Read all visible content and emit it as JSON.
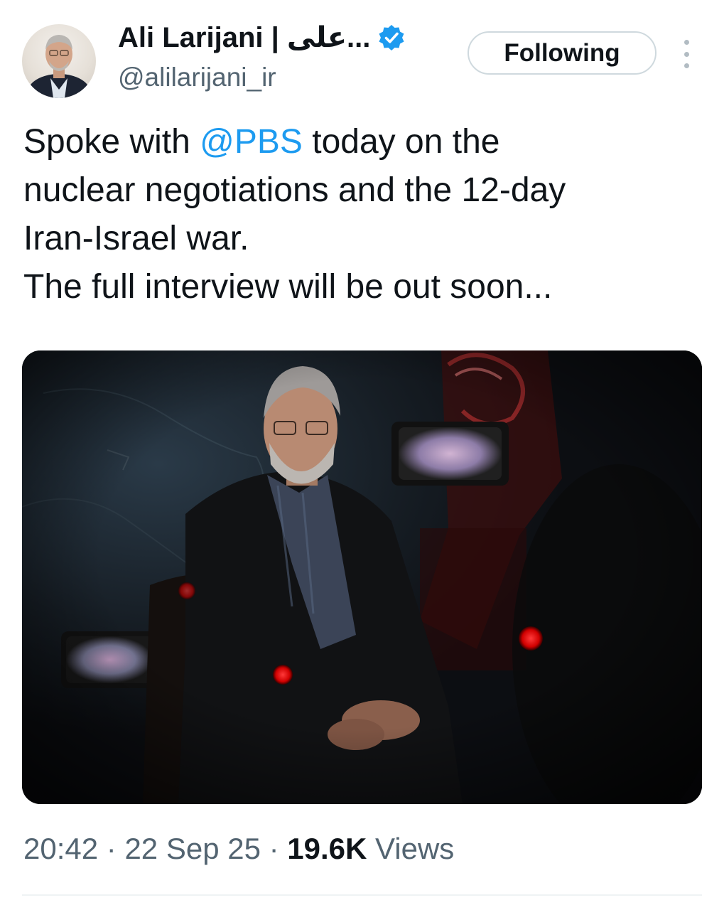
{
  "author": {
    "name": "Ali Larijani | علی...",
    "handle": "@alilarijani_ir",
    "verified": true,
    "avatar_icon": "user-avatar"
  },
  "follow_button": {
    "label": "Following"
  },
  "more_icon": "more-vertical-icon",
  "tweet": {
    "text_part1": "Spoke with ",
    "mention": "@PBS",
    "text_part2": " today on the",
    "line2": "nuclear negotiations and the 12-day",
    "line3": "Iran-Israel war.",
    "line4": "The full interview will be out soon..."
  },
  "meta": {
    "time": "20:42",
    "separator": " · ",
    "date": "22 Sep 25",
    "views_count": "19.6K",
    "views_label": " Views"
  },
  "colors": {
    "accent": "#1d9bf0",
    "text": "#0f1419",
    "muted": "#536471"
  }
}
